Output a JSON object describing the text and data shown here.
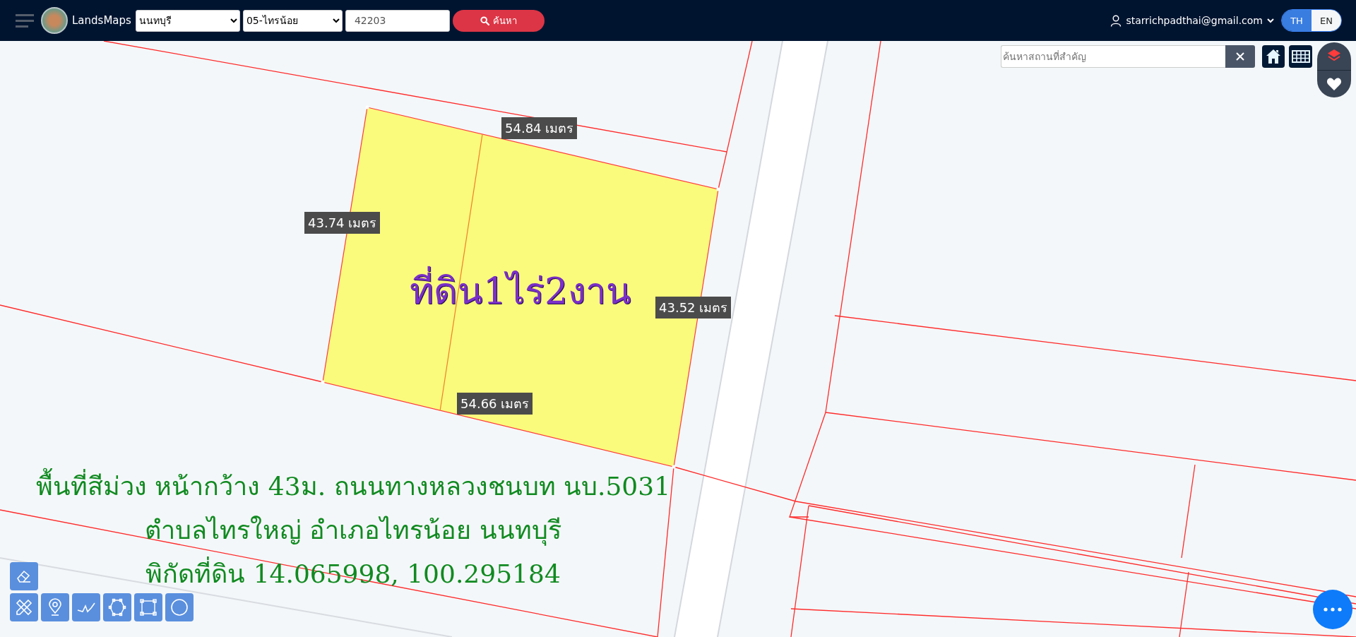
{
  "header": {
    "logo_text": "LandsMaps",
    "province": "นนทบุรี",
    "district": "05-ไทรน้อย",
    "parcel_number": "42203",
    "search_button": "ค้นหา",
    "user_email": "starrichpadthai@gmail.com",
    "languages": [
      {
        "label": "TH",
        "selected": true
      },
      {
        "label": "EN",
        "selected": false
      }
    ]
  },
  "place_search": {
    "placeholder": "ค้นหาสถานที่สำคัญ"
  },
  "map": {
    "parcel_title": "ที่ดิน1ไร่2งาน",
    "measurements": [
      "54.84 เมตร",
      "43.74 เมตร",
      "43.52 เมตร",
      "54.66 เมตร"
    ],
    "annotation_lines": [
      "พื้นที่สีม่วง หน้ากว้าง 43ม. ถนนทางหลวงชนบท นบ.5031",
      "ตำบลไทรใหญ่ อำเภอไทรน้อย นนทบุรี",
      "พิกัดที่ดิน 14.065998, 100.295184"
    ]
  }
}
